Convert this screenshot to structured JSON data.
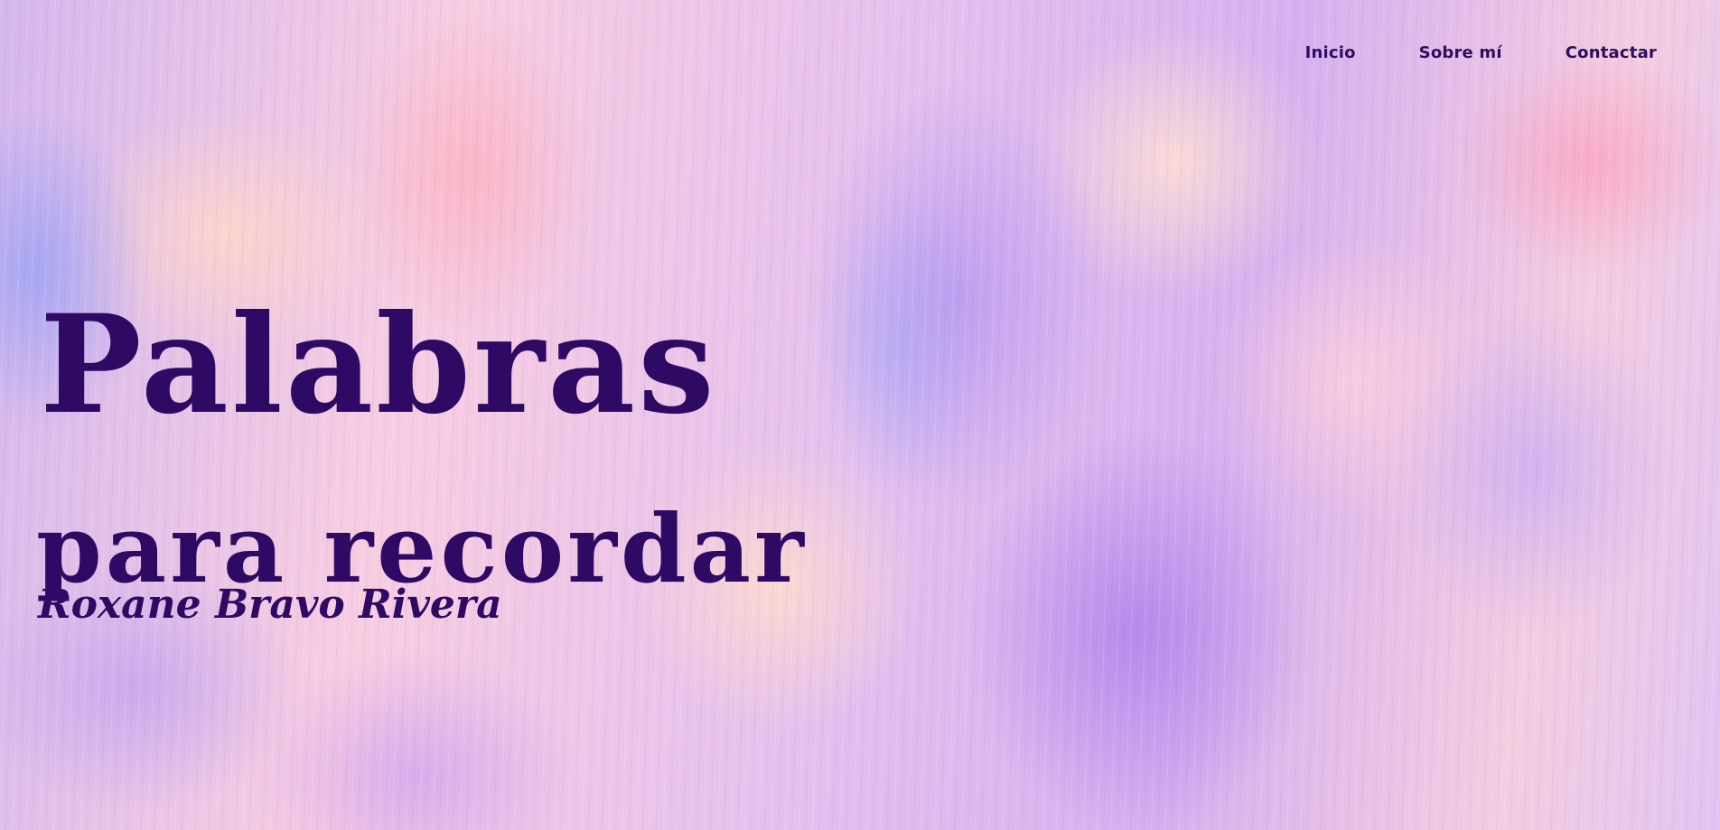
{
  "nav": {
    "items": [
      "Inicio",
      "Sobre mí",
      "Contactar"
    ]
  },
  "hero": {
    "title_line_1": "Palabras",
    "title_line_2": "para recordar",
    "author": "Roxane Bravo Rivera"
  },
  "colors": {
    "text": "#2f0a64",
    "background_palette": [
      "#d4b7ee",
      "#f7cde1",
      "#b482eb",
      "#a0b4fa",
      "#ffd7c8"
    ]
  }
}
